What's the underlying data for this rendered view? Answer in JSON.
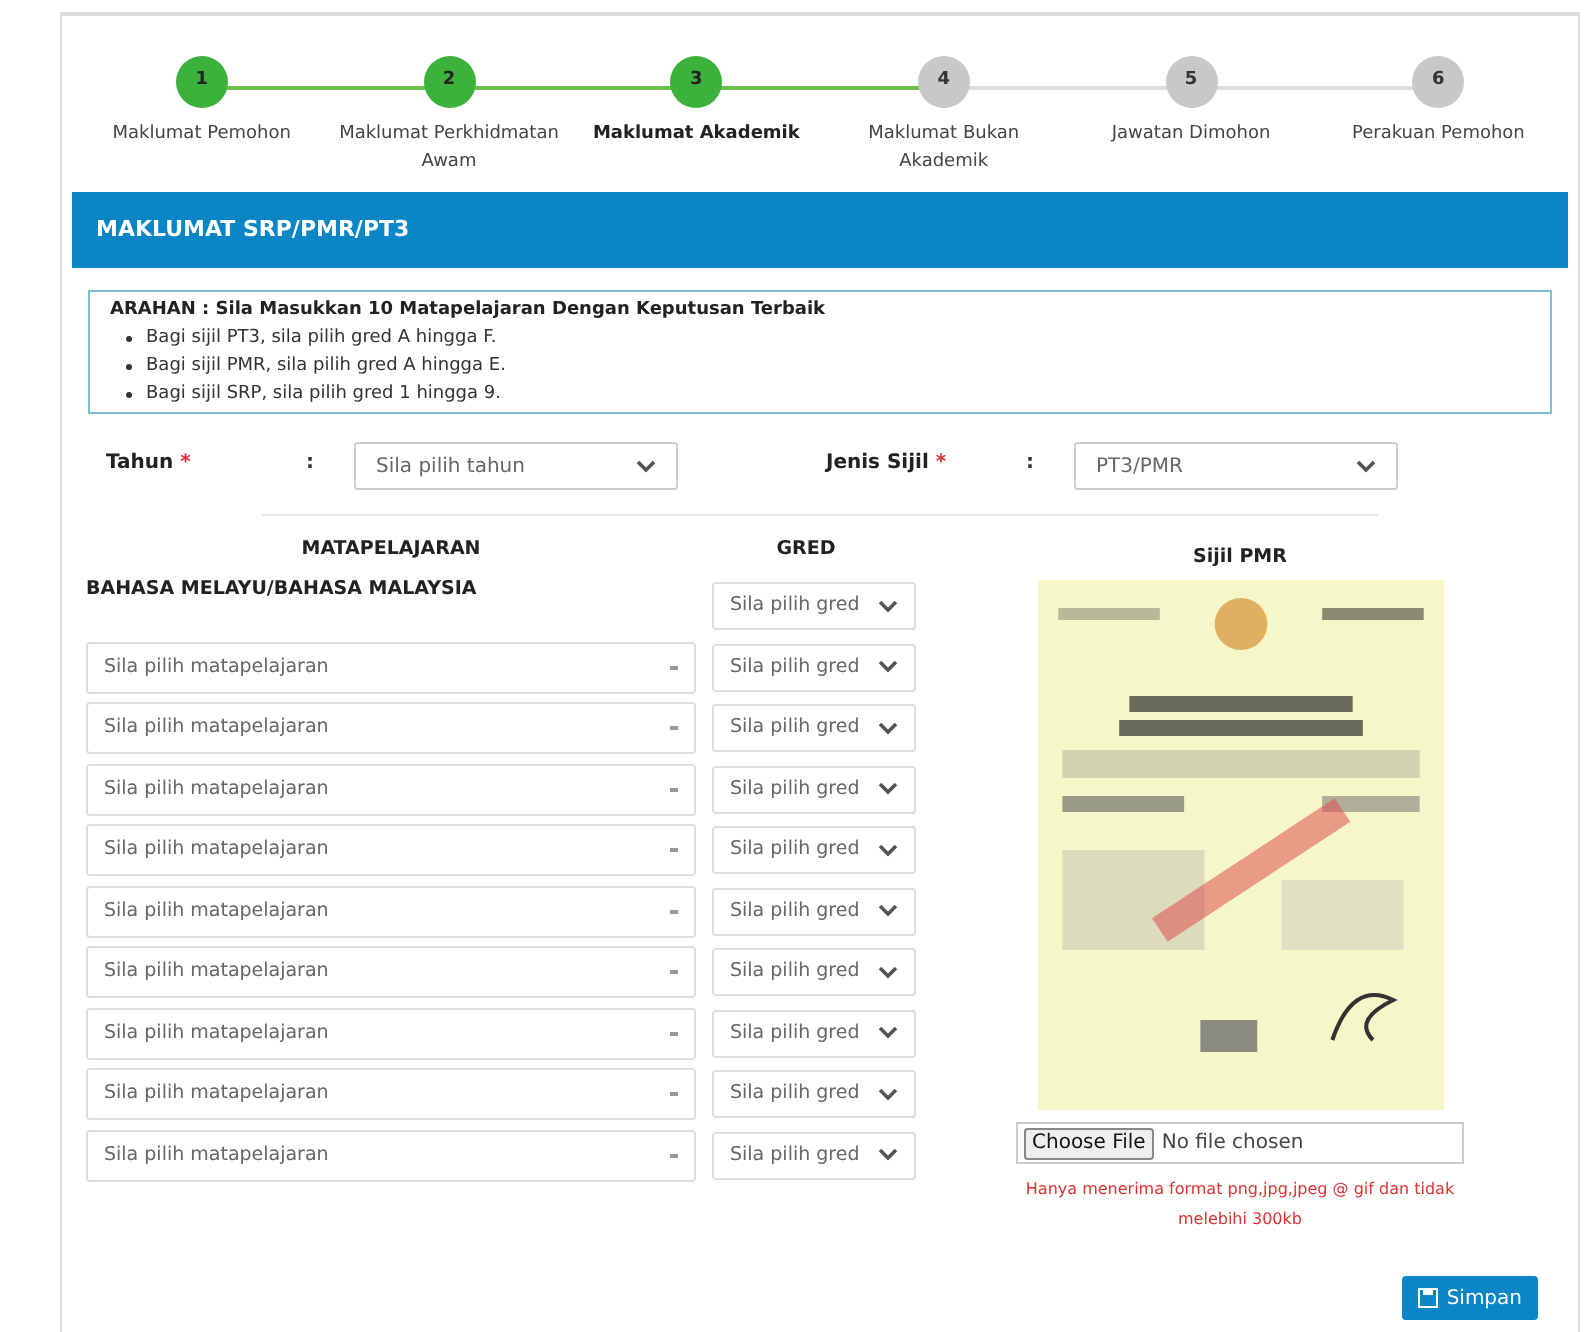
{
  "steps": [
    {
      "number": "1",
      "label": "Maklumat Pemohon",
      "done": true,
      "current": false
    },
    {
      "number": "2",
      "label": "Maklumat Perkhidmatan Awam",
      "done": true,
      "current": false
    },
    {
      "number": "3",
      "label": "Maklumat Akademik",
      "done": true,
      "current": true
    },
    {
      "number": "4",
      "label": "Maklumat Bukan Akademik",
      "done": false,
      "current": false
    },
    {
      "number": "5",
      "label": "Jawatan Dimohon",
      "done": false,
      "current": false
    },
    {
      "number": "6",
      "label": "Perakuan Pemohon",
      "done": false,
      "current": false
    }
  ],
  "section_title": "MAKLUMAT SRP/PMR/PT3",
  "instructions": {
    "heading": "ARAHAN : Sila Masukkan 10 Matapelajaran Dengan Keputusan Terbaik",
    "items": [
      "Bagi sijil PT3, sila pilih gred A hingga F.",
      "Bagi sijil PMR, sila pilih gred A hingga E.",
      "Bagi sijil SRP, sila pilih gred 1 hingga 9."
    ]
  },
  "fields": [
    {
      "label": "Tahun",
      "required_mark": "*",
      "colon": ":",
      "value": "Sila pilih tahun"
    },
    {
      "label": "Jenis Sijil",
      "required_mark": "*",
      "colon": ":",
      "value": "PT3/PMR"
    }
  ],
  "columns": [
    "MATAPELAJARAN",
    "GRED"
  ],
  "subjects": [
    {
      "kind": "fixed",
      "subject": "BAHASA MELAYU/BAHASA MALAYSIA",
      "grade": "Sila pilih gred"
    },
    {
      "kind": "select",
      "subject": "Sila pilih matapelajaran",
      "grade": "Sila pilih gred"
    },
    {
      "kind": "select",
      "subject": "Sila pilih matapelajaran",
      "grade": "Sila pilih gred"
    },
    {
      "kind": "select",
      "subject": "Sila pilih matapelajaran",
      "grade": "Sila pilih gred"
    },
    {
      "kind": "select",
      "subject": "Sila pilih matapelajaran",
      "grade": "Sila pilih gred"
    },
    {
      "kind": "select",
      "subject": "Sila pilih matapelajaran",
      "grade": "Sila pilih gred"
    },
    {
      "kind": "select",
      "subject": "Sila pilih matapelajaran",
      "grade": "Sila pilih gred"
    },
    {
      "kind": "select",
      "subject": "Sila pilih matapelajaran",
      "grade": "Sila pilih gred"
    },
    {
      "kind": "select",
      "subject": "Sila pilih matapelajaran",
      "grade": "Sila pilih gred"
    },
    {
      "kind": "select",
      "subject": "Sila pilih matapelajaran",
      "grade": "Sila pilih gred"
    }
  ],
  "certificate": {
    "title": "Sijil PMR",
    "file_button": "Choose File",
    "file_status": "No file chosen",
    "note": "Hanya menerima format png,jpg,jpeg @ gif dan tidak melebihi 300kb"
  },
  "save_button": "Simpan"
}
